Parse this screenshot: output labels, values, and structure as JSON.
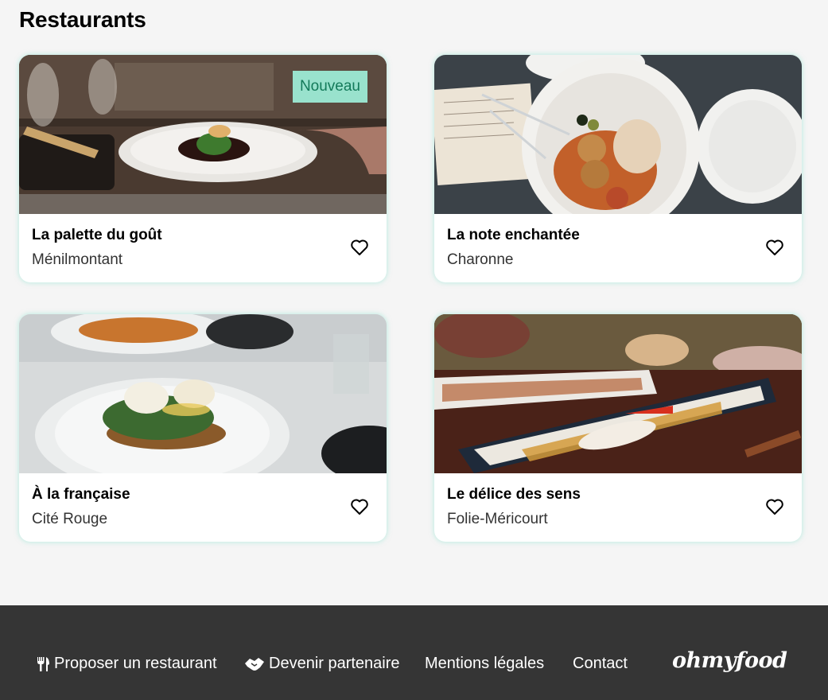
{
  "page": {
    "title": "Restaurants"
  },
  "restaurants": [
    {
      "name": "La palette du goût",
      "area": "Ménilmontant",
      "badge": "Nouveau"
    },
    {
      "name": "La note enchantée",
      "area": "Charonne"
    },
    {
      "name": "À la française",
      "area": "Cité Rouge"
    },
    {
      "name": "Le délice des sens",
      "area": "Folie-Méricourt"
    }
  ],
  "footer": {
    "links": [
      {
        "label": "Proposer un restaurant",
        "icon": "utensils-icon"
      },
      {
        "label": "Devenir partenaire",
        "icon": "handshake-icon"
      },
      {
        "label": "Mentions légales"
      },
      {
        "label": "Contact"
      }
    ],
    "logo": "ohmyfood"
  },
  "colors": {
    "accent": "#99e2cd",
    "footer_bg": "#353535"
  }
}
